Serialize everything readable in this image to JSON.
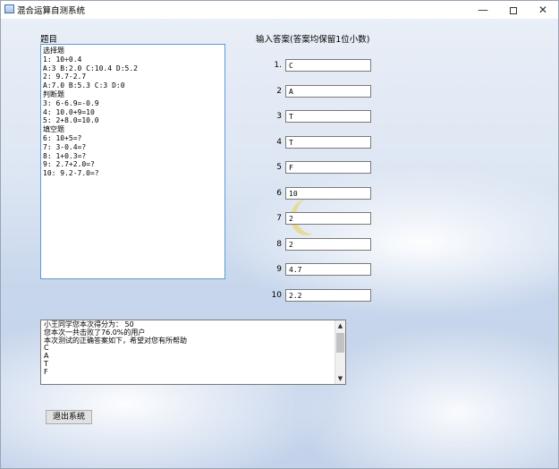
{
  "window": {
    "title": "混合运算自测系统",
    "controls": {
      "minimize": "—",
      "close": "✕"
    }
  },
  "questions": {
    "label": "题目",
    "lines": [
      "选择题",
      "1: 10÷0.4",
      "A:3 B:2.0 C:10.4 D:5.2",
      "2: 9.7-2.7",
      "A:7.0 B:5.3 C:3 D:0",
      "判断题",
      "3: 6-6.9=-0.9",
      "4: 10.0+9=10",
      "5: 2+8.0=10.0",
      "填空题",
      "6: 10+5=?",
      "7: 3-0.4=?",
      "8: 1+0.3=?",
      "9: 2.7+2.0=?",
      "10: 9.2-7.0=?"
    ]
  },
  "answers": {
    "label": "输入答案(答案均保留1位小数)",
    "items": [
      {
        "num": "1.",
        "value": "C"
      },
      {
        "num": "2",
        "value": "A"
      },
      {
        "num": "3",
        "value": "T"
      },
      {
        "num": "4",
        "value": "T"
      },
      {
        "num": "5",
        "value": "F"
      },
      {
        "num": "6",
        "value": "10"
      },
      {
        "num": "7",
        "value": "2"
      },
      {
        "num": "8",
        "value": "2"
      },
      {
        "num": "9",
        "value": "4.7"
      },
      {
        "num": "10",
        "value": "2.2"
      }
    ]
  },
  "result": {
    "lines": [
      "小王同学您本次得分为： 50",
      "您本次一共击败了76.0%的用户",
      "本次测试的正确答案如下，希望对您有所帮助",
      "C",
      "A",
      "T",
      "F"
    ],
    "scroll_up": "▲",
    "scroll_down": "▼"
  },
  "exit_button": "退出系统"
}
